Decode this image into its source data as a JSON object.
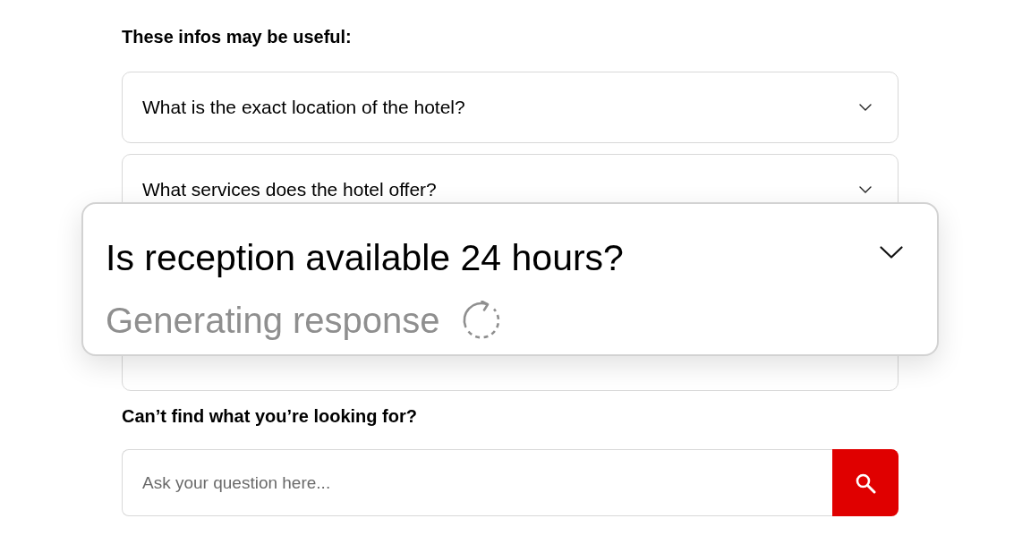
{
  "faq": {
    "heading": "These infos may be useful:",
    "items": [
      {
        "question": "What is the exact location of the hotel?"
      },
      {
        "question": "What services does the hotel offer?"
      }
    ]
  },
  "focused_card": {
    "question": "Is reception available 24 hours?",
    "status": "Generating response"
  },
  "search": {
    "heading": "Can’t find what you’re looking for?",
    "placeholder": "Ask your question here..."
  }
}
